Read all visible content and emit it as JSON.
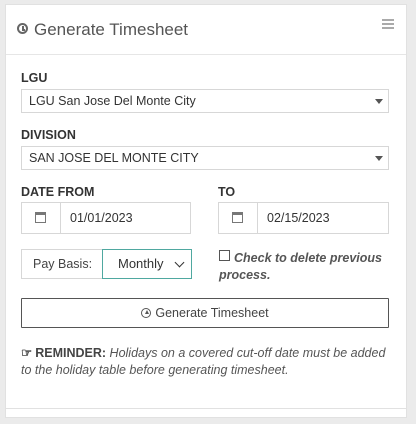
{
  "header": {
    "title": "Generate Timesheet",
    "icons": [
      "clock-icon",
      "list-icon"
    ]
  },
  "lgu": {
    "label": "LGU",
    "value": "LGU San Jose Del Monte City"
  },
  "division": {
    "label": "DIVISION",
    "value": "SAN JOSE DEL MONTE CITY"
  },
  "date_from": {
    "label": "DATE FROM",
    "value": "01/01/2023"
  },
  "date_to": {
    "label": "TO",
    "value": "02/15/2023"
  },
  "pay_basis": {
    "label": "Pay Basis:",
    "value": "Monthly"
  },
  "delete_previous": {
    "label": "Check to delete previous process.",
    "checked": false
  },
  "generate_button": {
    "label": "Generate Timesheet"
  },
  "reminder": {
    "prefix": "REMINDER:",
    "text": "Holidays on a covered cut-off date must be added to the holiday table before generating timesheet."
  },
  "colors": {
    "accent": "#4fa8a0",
    "border": "#d7d7d7",
    "background": "#ebebeb"
  }
}
